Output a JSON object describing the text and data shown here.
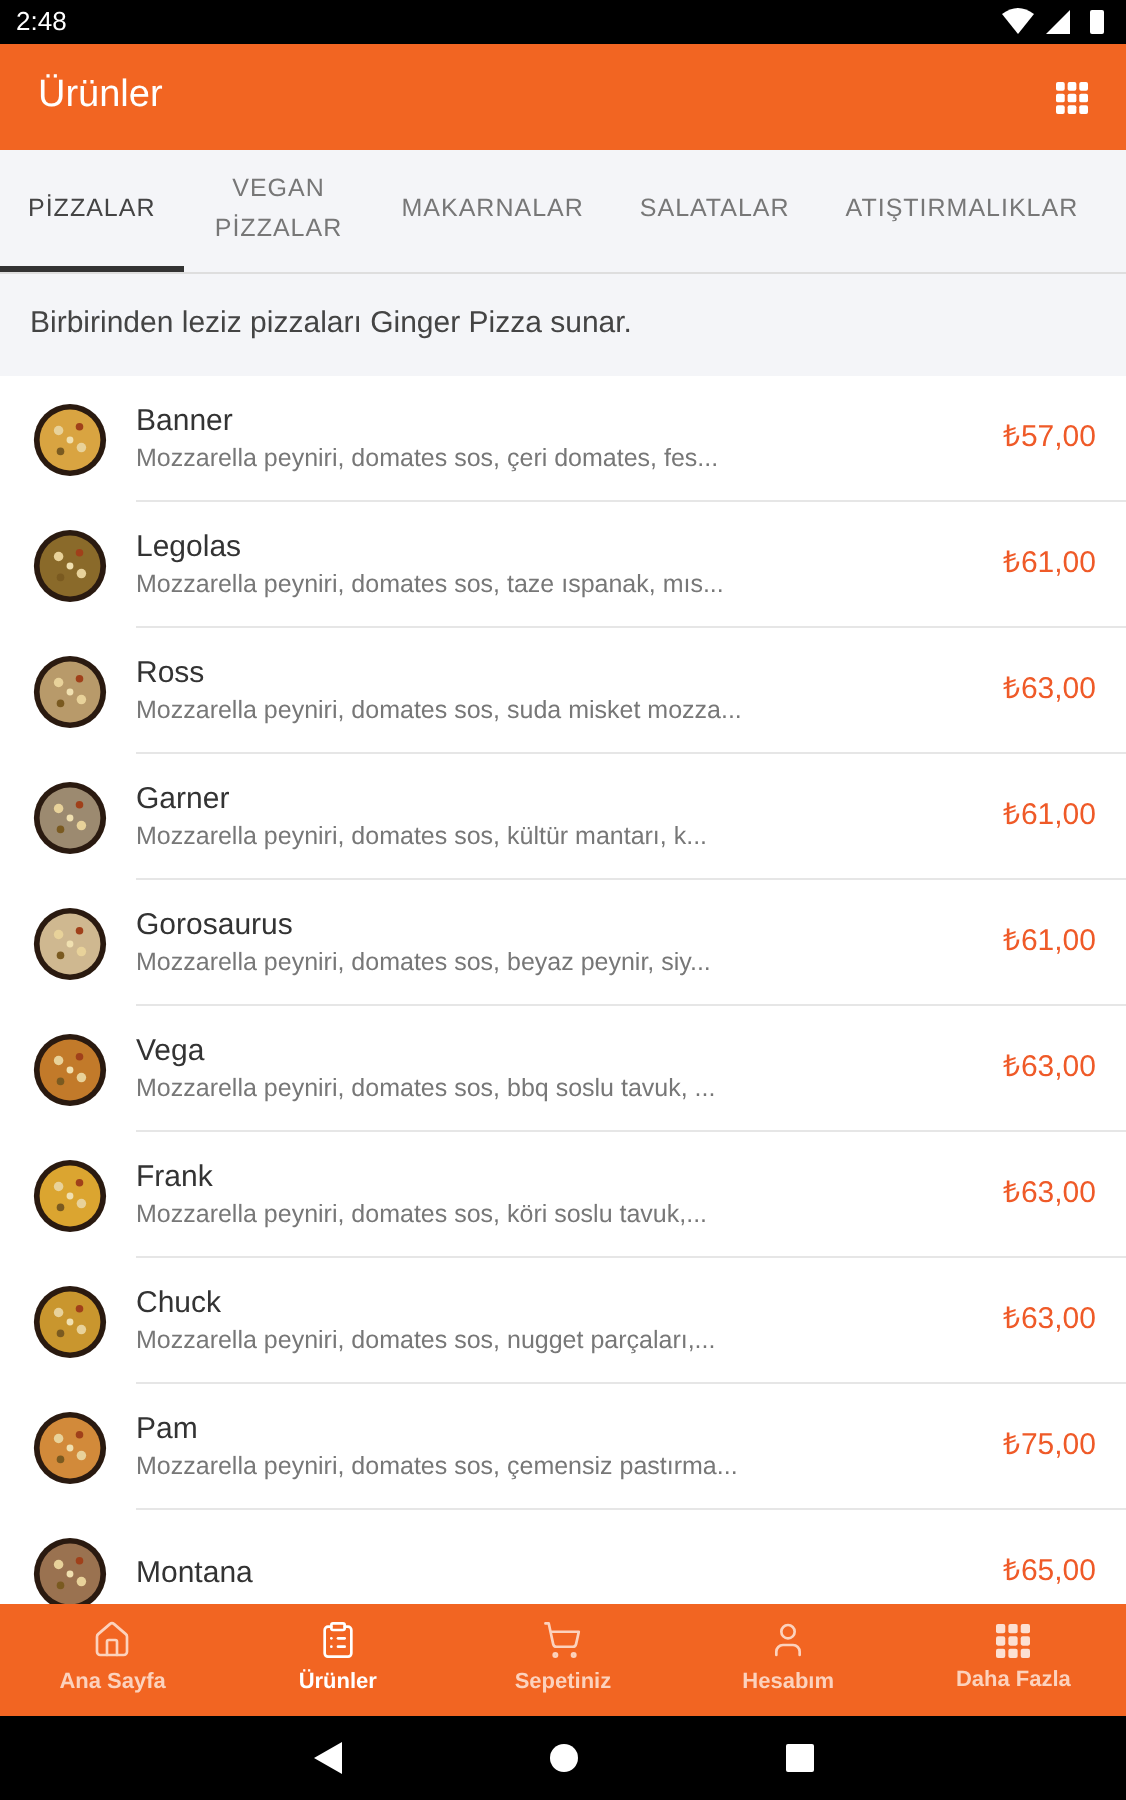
{
  "status_bar": {
    "time": "2:48"
  },
  "app_bar": {
    "title": "Ürünler"
  },
  "tabs": [
    {
      "label": "PİZZALAR",
      "selected": true
    },
    {
      "label": "VEGAN PİZZALAR",
      "selected": false
    },
    {
      "label": "MAKARNALAR",
      "selected": false
    },
    {
      "label": "SALATALAR",
      "selected": false
    },
    {
      "label": "ATIŞTIRMALIKLAR",
      "selected": false
    }
  ],
  "category_description": "Birbirinden leziz pizzaları Ginger Pizza sunar.",
  "products": [
    {
      "name": "Banner",
      "description": "Mozzarella peyniri, domates sos, çeri domates, fes...",
      "price": "₺57,00"
    },
    {
      "name": "Legolas",
      "description": "Mozzarella peyniri, domates sos, taze ıspanak, mıs...",
      "price": "₺61,00"
    },
    {
      "name": "Ross",
      "description": "Mozzarella peyniri, domates sos, suda misket mozza...",
      "price": "₺63,00"
    },
    {
      "name": "Garner",
      "description": "Mozzarella peyniri, domates sos, kültür mantarı, k...",
      "price": "₺61,00"
    },
    {
      "name": "Gorosaurus",
      "description": "Mozzarella peyniri, domates sos, beyaz peynir, siy...",
      "price": "₺61,00"
    },
    {
      "name": "Vega",
      "description": "Mozzarella peyniri, domates sos, bbq soslu tavuk, ...",
      "price": "₺63,00"
    },
    {
      "name": "Frank",
      "description": "Mozzarella peyniri, domates sos, köri soslu tavuk,...",
      "price": "₺63,00"
    },
    {
      "name": "Chuck",
      "description": "Mozzarella peyniri, domates sos, nugget parçaları,...",
      "price": "₺63,00"
    },
    {
      "name": "Pam",
      "description": "Mozzarella peyniri, domates sos, çemensiz pastırma...",
      "price": "₺75,00"
    },
    {
      "name": "Montana",
      "price": "₺65,00"
    }
  ],
  "bottom_nav": [
    {
      "label": "Ana Sayfa",
      "kind": "home",
      "selected": false
    },
    {
      "label": "Ürünler",
      "kind": "products",
      "selected": true
    },
    {
      "label": "Sepetiniz",
      "kind": "cart",
      "selected": false
    },
    {
      "label": "Hesabım",
      "kind": "account",
      "selected": false
    },
    {
      "label": "Daha Fazla",
      "kind": "more",
      "selected": false
    }
  ]
}
